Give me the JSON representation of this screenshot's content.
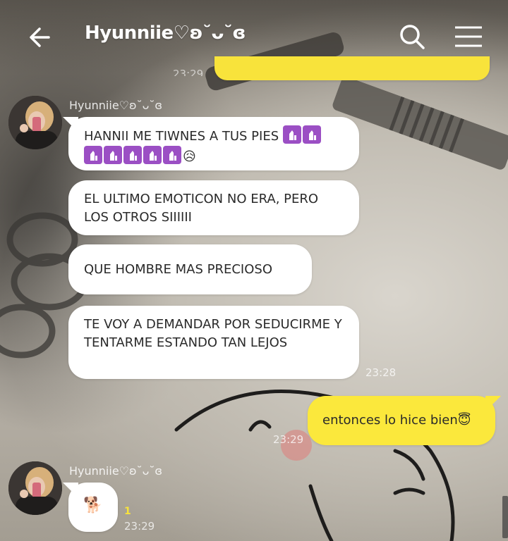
{
  "header": {
    "title": "Hyunniie♡ʚ˘ᴗ˘ɞ",
    "back_icon": "arrow-left-icon",
    "search_icon": "search-icon",
    "menu_icon": "hamburger-menu-icon"
  },
  "top_message": {
    "time": "23:29"
  },
  "groups": [
    {
      "sender": "Hyunniie♡ʚ˘ᴗ˘ɞ",
      "messages": [
        {
          "text": "HANNII ME TIWNES A TUS PIES",
          "trail_emoji_count_line1": 2,
          "line2_emoji": "🛐🛐🛐🛐🛐😥"
        },
        {
          "text": "EL ULTIMO EMOTICON NO ERA, PERO LOS OTROS SIIIIII"
        },
        {
          "text": "QUE HOMBRE MAS PRECIOSO"
        },
        {
          "text": "TE VOY A DEMANDAR POR SEDUCIRME Y TENTARME ESTANDO TAN LEJOS"
        }
      ],
      "time": "23:28"
    }
  ],
  "mine": {
    "text": "entonces lo hice bien😇",
    "time": "23:29"
  },
  "group2": {
    "sender": "Hyunniie♡ʚ˘ᴗ˘ɞ",
    "sticker": "🐕",
    "unread": "1",
    "time": "23:29"
  },
  "colors": {
    "mine_bubble": "#fbe83c",
    "their_bubble": "#ffffff",
    "prayer_badge": "#9b4fc4"
  }
}
